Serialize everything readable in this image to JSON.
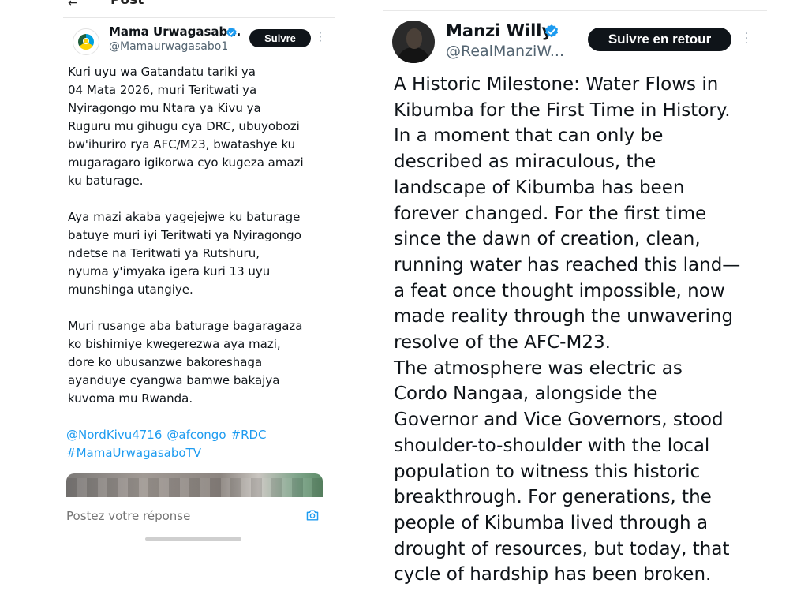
{
  "left_post": {
    "header": {
      "back_glyph": "←",
      "title": "Post"
    },
    "author": {
      "name": "Mama Urwagasab...",
      "handle": "@Mamaurwagasabo1",
      "follow_label": "Suivre"
    },
    "paragraphs": [
      "Kuri uyu wa Gatandatu tariki ya\n04 Mata 2026, muri Teritwati ya\nNyiragongo mu Ntara ya Kivu ya\nRuguru mu gihugu cya DRC, ubuyobozi\nbw'ihuriro rya AFC/M23, bwatashye ku\nmugaragaro igikorwa cyo kugeza amazi\nku baturage.",
      "Aya mazi akaba yagejejwe ku baturage\nbatuye muri iyi Teritwati ya Nyiragongo\nndetse na Teritwati ya Rutshuru,\nnyuma y'imyaka igera kuri 13 uyu\nmunshinga utangiye.",
      "Muri rusange aba baturage bagaragaza\nko bishimiye kwegerezwa aya mazi,\ndore ko ubusanzwe bakoreshaga\nayanduye cyangwa bamwe bakajya\nkuvoma mu Rwanda."
    ],
    "hashtags": [
      "@NordKivu4716",
      "@afcongo",
      "#RDC",
      "#MamaUrwagasaboTV"
    ],
    "reply_placeholder": "Postez votre réponse"
  },
  "right_post": {
    "author": {
      "name": "Manzi Willy",
      "handle": "@RealManziW...",
      "follow_label": "Suivre en retour"
    },
    "paragraphs": [
      "A Historic Milestone: Water Flows in\nKibumba for the First Time in History.\nIn a moment that can only be\ndescribed as miraculous, the\nlandscape of Kibumba has been\nforever changed. For the first time\nsince the dawn of creation, clean,\nrunning water has reached this land—\na feat once thought impossible, now\nmade reality through the unwavering\nresolve of the AFC-M23.",
      "The atmosphere was electric as\nCordo Nangaa, alongside the\nGovernor and Vice Governors, stood\nshoulder-to-shoulder with the local\npopulation to witness this historic\nbreakthrough. For generations, the\npeople of Kibumba lived through a\ndrought of resources, but today, that\ncycle of hardship has been broken."
    ]
  },
  "icons": {
    "verified": "verified-badge-icon",
    "more": "more-vertical-icon",
    "camera": "camera-icon",
    "back": "back-arrow-icon"
  },
  "colors": {
    "text": "#0f1419",
    "muted": "#536471",
    "link": "#1d9bf0",
    "verified": "#1d9bf0",
    "button": "#0f1419"
  }
}
